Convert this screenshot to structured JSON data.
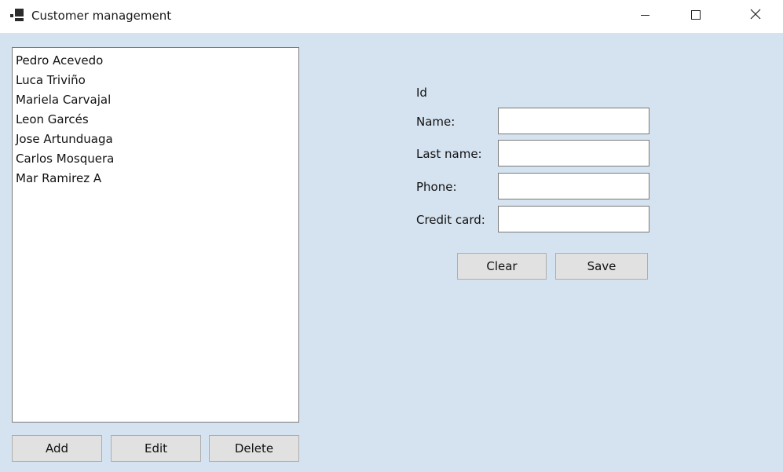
{
  "window": {
    "title": "Customer management",
    "icon": "app-window-icon",
    "controls": [
      "minimize-icon",
      "maximize-icon",
      "close-icon"
    ]
  },
  "customers": {
    "items": [
      "Pedro Acevedo",
      "Luca Triviño",
      "Mariela Carvajal",
      "Leon Garcés",
      "Jose Artunduaga",
      "Carlos Mosquera",
      "Mar Ramirez A"
    ]
  },
  "list_actions": {
    "add": "Add",
    "edit": "Edit",
    "delete": "Delete"
  },
  "form": {
    "id_label": "Id",
    "name_label": "Name:",
    "name_value": "",
    "last_name_label": "Last name:",
    "last_name_value": "",
    "phone_label": "Phone:",
    "phone_value": "",
    "credit_card_label": "Credit card:",
    "credit_card_value": "",
    "clear": "Clear",
    "save": "Save"
  },
  "colors": {
    "window_background": "#d5e3f0",
    "titlebar_background": "#ffffff",
    "button_background": "#e1e1e1"
  }
}
